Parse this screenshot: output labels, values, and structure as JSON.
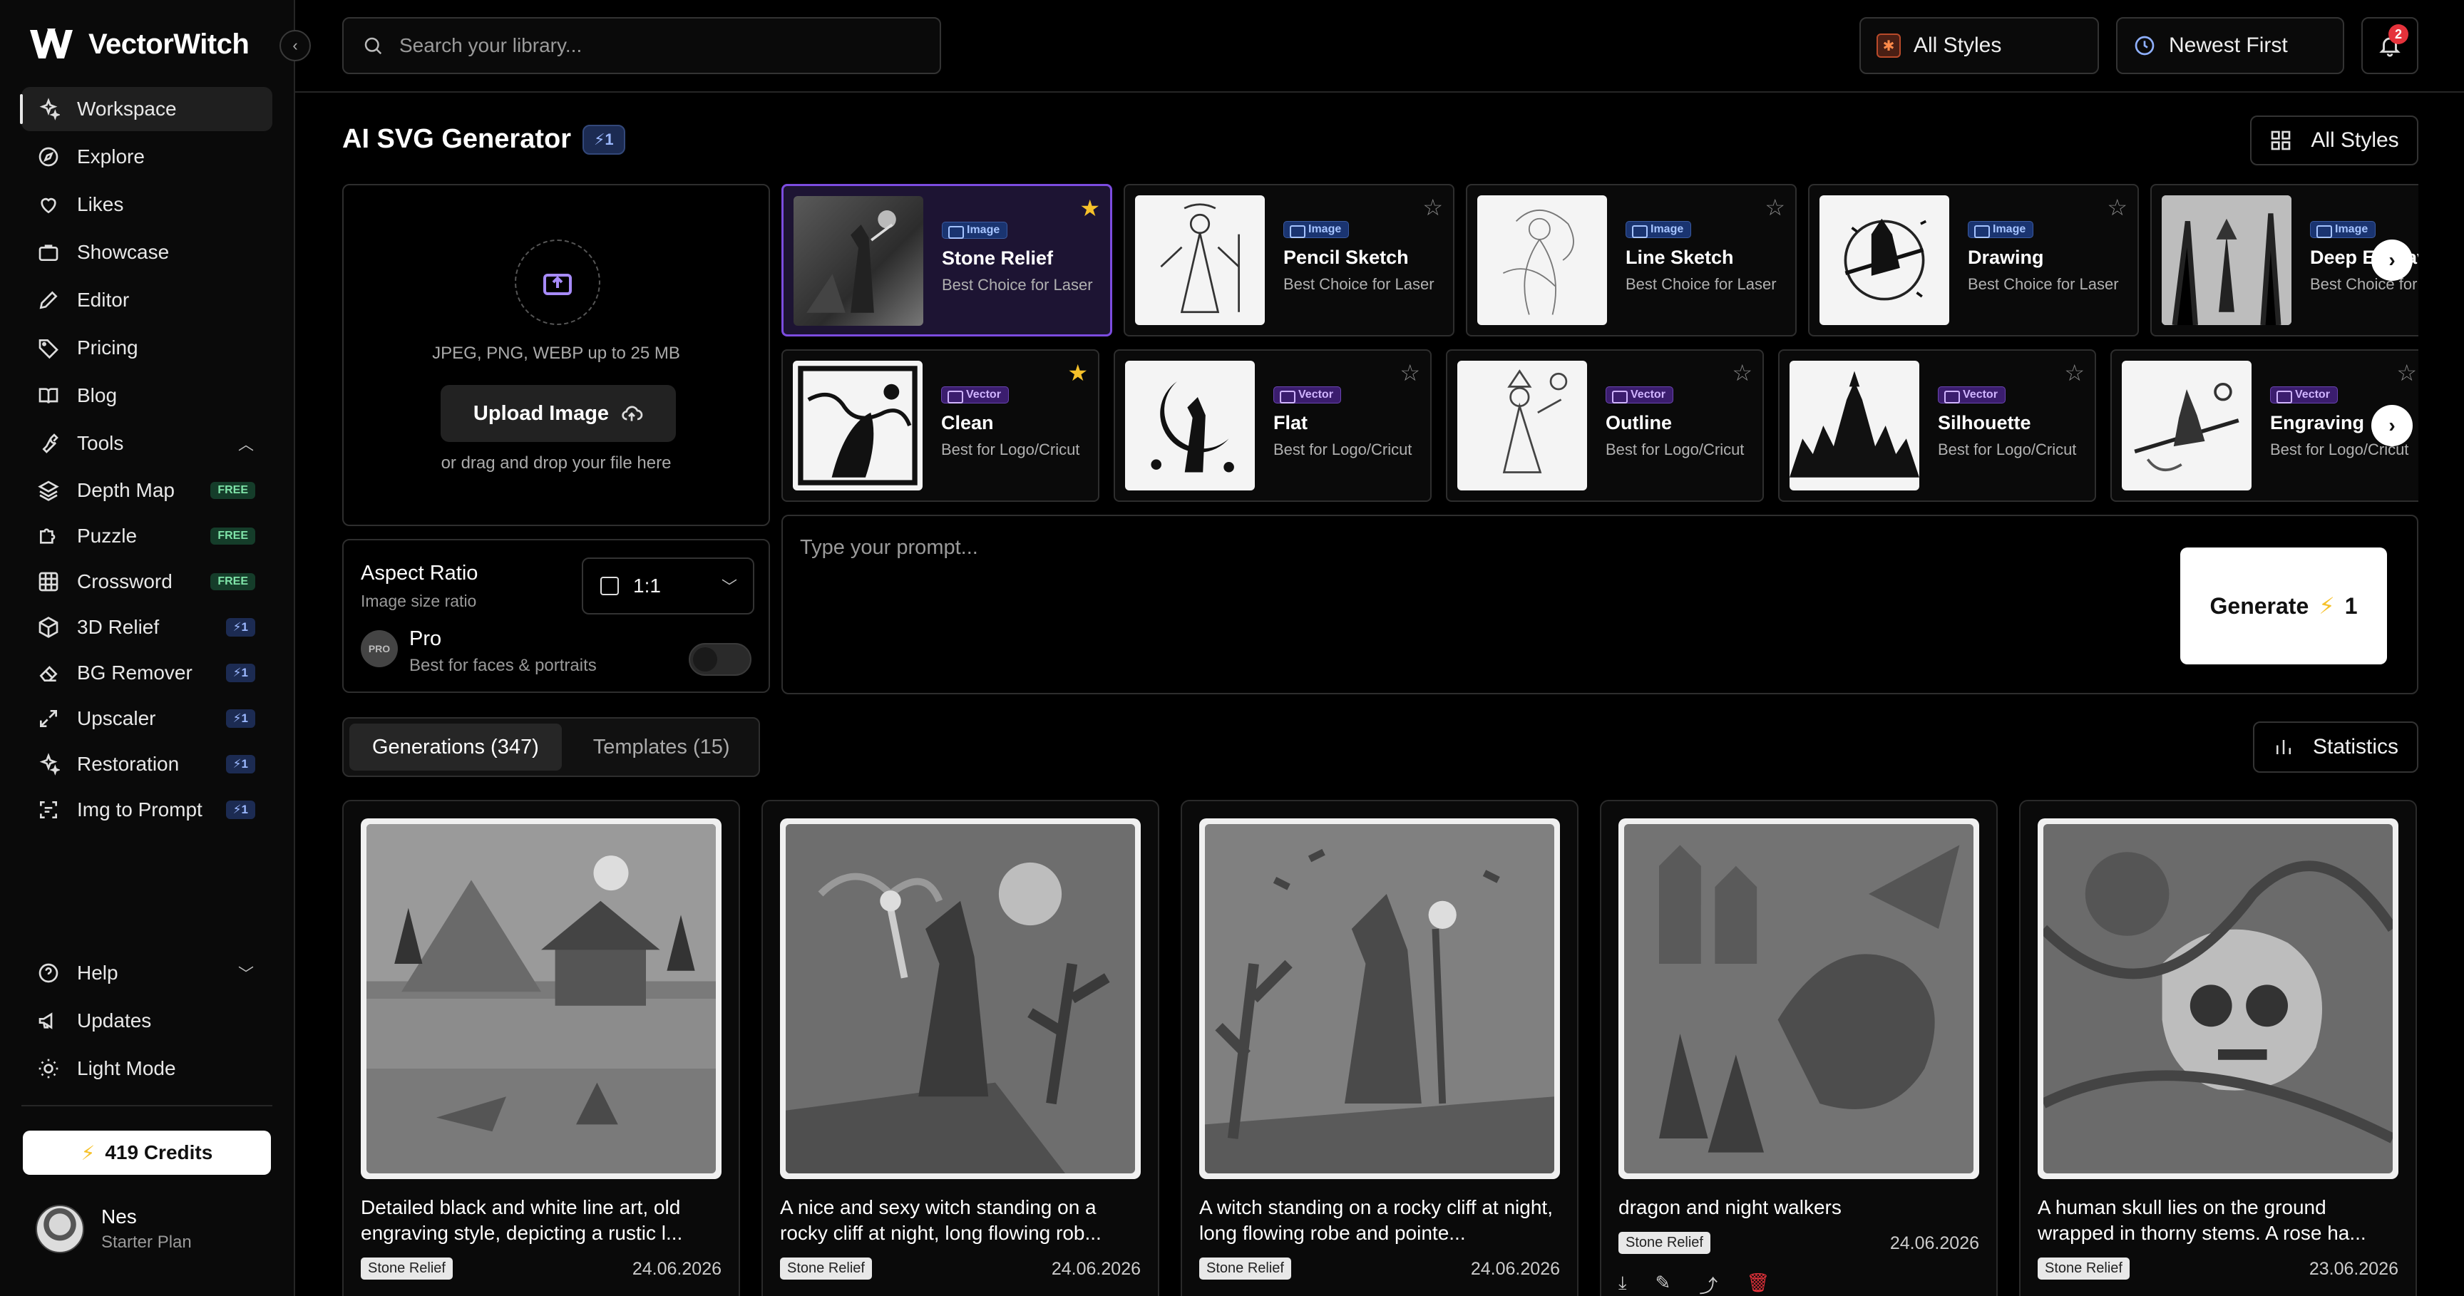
{
  "app": {
    "name": "VectorWitch"
  },
  "sidebar": {
    "nav": [
      {
        "label": "Workspace",
        "icon": "sparkles-icon",
        "active": true
      },
      {
        "label": "Explore",
        "icon": "compass-icon"
      },
      {
        "label": "Likes",
        "icon": "heart-icon"
      },
      {
        "label": "Showcase",
        "icon": "briefcase-icon"
      },
      {
        "label": "Editor",
        "icon": "pencil-icon"
      },
      {
        "label": "Pricing",
        "icon": "tag-icon"
      },
      {
        "label": "Blog",
        "icon": "book-icon"
      },
      {
        "label": "Tools",
        "icon": "wrench-icon"
      }
    ],
    "tools": [
      {
        "label": "Depth Map",
        "badge": "FREE",
        "icon": "layers-icon"
      },
      {
        "label": "Puzzle",
        "badge": "FREE",
        "icon": "puzzle-icon"
      },
      {
        "label": "Crossword",
        "badge": "FREE",
        "icon": "grid-icon"
      },
      {
        "label": "3D Relief",
        "badge": "⚡1",
        "icon": "cube-icon"
      },
      {
        "label": "BG Remover",
        "badge": "⚡1",
        "icon": "eraser-icon"
      },
      {
        "label": "Upscaler",
        "badge": "⚡1",
        "icon": "expand-icon"
      },
      {
        "label": "Restoration",
        "badge": "⚡1",
        "icon": "sparkle-icon"
      },
      {
        "label": "Img to Prompt",
        "badge": "⚡1",
        "icon": "text-scan-icon"
      }
    ],
    "bottom": [
      {
        "label": "Help",
        "icon": "help-icon"
      },
      {
        "label": "Updates",
        "icon": "megaphone-icon"
      },
      {
        "label": "Light Mode",
        "icon": "sun-icon"
      }
    ],
    "credits": "419 Credits",
    "user": {
      "name": "Nes",
      "plan": "Starter Plan"
    }
  },
  "topbar": {
    "search_placeholder": "Search your library...",
    "style_filter": "All Styles",
    "sort": "Newest First",
    "notifications": "2"
  },
  "main": {
    "title": "AI SVG Generator",
    "title_badge": "⚡1",
    "all_styles_button": "All Styles",
    "upload": {
      "hint": "JPEG, PNG, WEBP up to 25 MB",
      "button": "Upload Image",
      "drag": "or drag and drop your file here"
    },
    "aspect": {
      "title": "Aspect Ratio",
      "subtitle": "Image size ratio",
      "value": "1:1",
      "pro_title": "Pro",
      "pro_subtitle": "Best for faces & portraits",
      "pro_badge": "PRO",
      "pro_enabled": false
    },
    "image_styles": [
      {
        "type": "Image",
        "name": "Stone Relief",
        "sub": "Best Choice for Laser",
        "starred": true,
        "selected": true
      },
      {
        "type": "Image",
        "name": "Pencil Sketch",
        "sub": "Best Choice for Laser",
        "starred": false
      },
      {
        "type": "Image",
        "name": "Line Sketch",
        "sub": "Best Choice for Laser",
        "starred": false
      },
      {
        "type": "Image",
        "name": "Drawing",
        "sub": "Best Choice for Laser",
        "starred": false
      },
      {
        "type": "Image",
        "name": "Deep Engraving",
        "sub": "Best Choice for Laser",
        "starred": false
      }
    ],
    "vector_styles": [
      {
        "type": "Vector",
        "name": "Clean",
        "sub": "Best for Logo/Cricut",
        "starred": true
      },
      {
        "type": "Vector",
        "name": "Flat",
        "sub": "Best for Logo/Cricut",
        "starred": false
      },
      {
        "type": "Vector",
        "name": "Outline",
        "sub": "Best for Logo/Cricut",
        "starred": false
      },
      {
        "type": "Vector",
        "name": "Silhouette",
        "sub": "Best for Logo/Cricut",
        "starred": false
      },
      {
        "type": "Vector",
        "name": "Engraving",
        "sub": "Best for Logo/Cricut",
        "starred": false
      }
    ],
    "prompt_placeholder": "Type your prompt...",
    "generate": {
      "label": "Generate",
      "cost": "1"
    },
    "tabs": [
      {
        "label": "Generations (347)",
        "active": true
      },
      {
        "label": "Templates (15)",
        "active": false
      }
    ],
    "statistics_button": "Statistics",
    "generations": [
      {
        "title": "Detailed black and white line art, old engraving style, depicting a rustic l...",
        "tag": "Stone Relief",
        "date": "24.06.2026"
      },
      {
        "title": "A nice and sexy witch standing on a rocky cliff at night, long flowing rob...",
        "tag": "Stone Relief",
        "date": "24.06.2026"
      },
      {
        "title": "A witch standing on a rocky cliff at night, long flowing robe and pointe...",
        "tag": "Stone Relief",
        "date": "24.06.2026"
      },
      {
        "title": "dragon and night walkers",
        "tag": "Stone Relief",
        "date": "24.06.2026"
      },
      {
        "title": "A human skull lies on the ground wrapped in thorny stems. A rose ha...",
        "tag": "Stone Relief",
        "date": "23.06.2026"
      }
    ]
  },
  "colors": {
    "accent": "#7c4ce0",
    "star": "#f6c12a",
    "free_badge": "#153d2a",
    "credit_badge": "#1c2b52"
  }
}
